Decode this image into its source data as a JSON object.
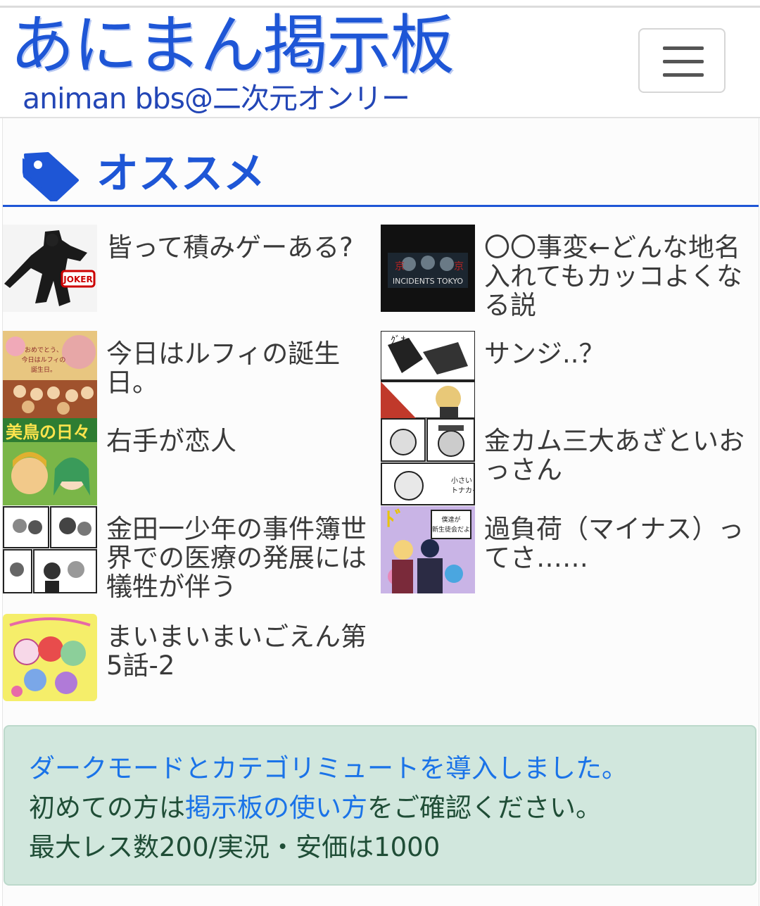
{
  "header": {
    "logo_main": "あにまん掲示板",
    "logo_sub": "animan bbs@二次元オンリー",
    "menu_icon": "hamburger-menu-icon"
  },
  "section": {
    "icon": "tag-icon",
    "title": "オススメ"
  },
  "items": [
    {
      "title": "皆って積みゲーある?",
      "thumb": "joker-character-thumbnail"
    },
    {
      "title": "〇〇事変←どんな地名入れてもカッコよくなる説",
      "thumb": "incidents-tokyo-thumbnail",
      "thumb_text": "INCIDENTS TOKYO"
    },
    {
      "title": "今日はルフィの誕生日。",
      "thumb": "luffy-birthday-thumbnail",
      "thumb_text": "おめでとう、今日はルフィの誕生日。"
    },
    {
      "title": "サンジ..？",
      "thumb": "sanji-manga-thumbnail"
    },
    {
      "title": "右手が恋人",
      "thumb": "mitori-no-hibi-thumbnail",
      "thumb_text": "美鳥の日々"
    },
    {
      "title": "金カム三大あざといおっさん",
      "thumb": "golden-kamuy-thumbnail"
    },
    {
      "title": "金田一少年の事件簿世界での医療の発展には犠牲が伴う",
      "thumb": "kindaichi-manga-thumbnail"
    },
    {
      "title": "過負荷（マイナス）ってさ……",
      "thumb": "medaka-box-thumbnail",
      "thumb_text": "僕達が新生徒会だよ"
    },
    {
      "title": "まいまいまいごえん第5話-2",
      "thumb": "maimai-maigoen-thumbnail"
    }
  ],
  "notice": {
    "line1_link": "ダークモードとカテゴリミュートを導入しました。",
    "line2_prefix": "初めての方は",
    "line2_link": "掲示板の使い方",
    "line2_suffix": "をご確認ください。",
    "line3": "最大レス数200/実況・安価は1000"
  },
  "colors": {
    "brand": "#1e56d6",
    "notice_bg": "#d1e7dd",
    "link": "#1a73e8"
  }
}
